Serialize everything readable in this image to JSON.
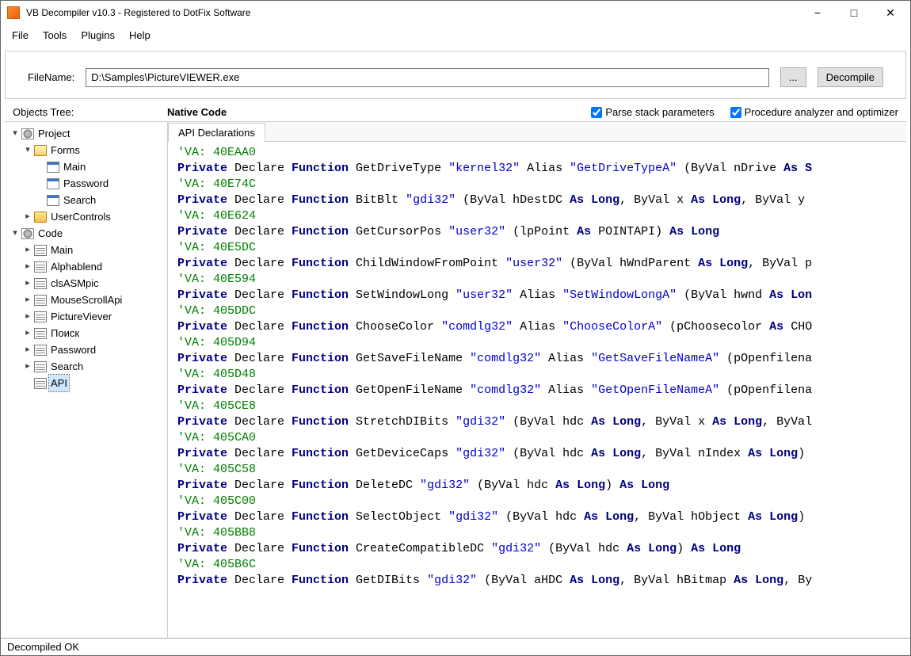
{
  "window": {
    "title": "VB Decompiler v10.3 - Registered to DotFix Software"
  },
  "menu": [
    "File",
    "Tools",
    "Plugins",
    "Help"
  ],
  "toolbar": {
    "filename_label": "FileName:",
    "filename_value": "D:\\Samples\\PictureVIEWER.exe",
    "browse": "...",
    "decompile": "Decompile"
  },
  "splitrow": {
    "objects_tree": "Objects Tree:",
    "native_code": "Native Code",
    "chk1": "Parse stack parameters",
    "chk2": "Procedure analyzer and optimizer"
  },
  "tree": {
    "project": "Project",
    "forms": "Forms",
    "form_items": [
      "Main",
      "Password",
      "Search"
    ],
    "usercontrols": "UserControls",
    "code": "Code",
    "code_items": [
      "Main",
      "Alphablend",
      "clsASMpic",
      "MouseScrollApi",
      "PictureViever",
      "Поиск",
      "Password",
      "Search",
      "API"
    ]
  },
  "tab": "API Declarations",
  "code_lines": [
    {
      "t": "comment",
      "text": "'VA: 40EAA0"
    },
    {
      "t": "decl",
      "fn": "GetDriveType",
      "lib": "kernel32",
      "alias": "GetDriveTypeA",
      "rest": " (ByVal nDrive ",
      "kw2": "As S"
    },
    {
      "t": "comment",
      "text": "'VA: 40E74C"
    },
    {
      "t": "decl",
      "fn": "BitBlt",
      "lib": "gdi32",
      "rest": " (ByVal hDestDC ",
      "kw2": "As Long",
      "rest2": ", ByVal x ",
      "kw3": "As Long",
      "rest3": ", ByVal y "
    },
    {
      "t": "comment",
      "text": "'VA: 40E624"
    },
    {
      "t": "decl",
      "fn": "GetCursorPos",
      "lib": "user32",
      "rest": " (lpPoint ",
      "kw2": "As",
      "rest2": " POINTAPI) ",
      "kw3": "As Long"
    },
    {
      "t": "comment",
      "text": "'VA: 40E5DC"
    },
    {
      "t": "decl",
      "fn": "ChildWindowFromPoint",
      "lib": "user32",
      "rest": " (ByVal hWndParent ",
      "kw2": "As Long",
      "rest2": ", ByVal p"
    },
    {
      "t": "comment",
      "text": "'VA: 40E594"
    },
    {
      "t": "decl",
      "fn": "SetWindowLong",
      "lib": "user32",
      "alias": "SetWindowLongA",
      "rest": " (ByVal hwnd ",
      "kw2": "As Lon"
    },
    {
      "t": "comment",
      "text": "'VA: 405DDC"
    },
    {
      "t": "decl",
      "fn": "ChooseColor",
      "lib": "comdlg32",
      "alias": "ChooseColorA",
      "rest": " (pChoosecolor ",
      "kw2": "As",
      "rest2": " CHO"
    },
    {
      "t": "comment",
      "text": "'VA: 405D94"
    },
    {
      "t": "decl",
      "fn": "GetSaveFileName",
      "lib": "comdlg32",
      "alias": "GetSaveFileNameA",
      "rest": " (pOpenfilena"
    },
    {
      "t": "comment",
      "text": "'VA: 405D48"
    },
    {
      "t": "decl",
      "fn": "GetOpenFileName",
      "lib": "comdlg32",
      "alias": "GetOpenFileNameA",
      "rest": " (pOpenfilena"
    },
    {
      "t": "comment",
      "text": "'VA: 405CE8"
    },
    {
      "t": "decl",
      "fn": "StretchDIBits",
      "lib": "gdi32",
      "rest": " (ByVal hdc ",
      "kw2": "As Long",
      "rest2": ", ByVal x ",
      "kw3": "As Long",
      "rest3": ", ByVal"
    },
    {
      "t": "comment",
      "text": "'VA: 405CA0"
    },
    {
      "t": "decl",
      "fn": "GetDeviceCaps",
      "lib": "gdi32",
      "rest": " (ByVal hdc ",
      "kw2": "As Long",
      "rest2": ", ByVal nIndex ",
      "kw3": "As Long",
      "rest3": ")"
    },
    {
      "t": "comment",
      "text": "'VA: 405C58"
    },
    {
      "t": "decl",
      "fn": "DeleteDC",
      "lib": "gdi32",
      "rest": " (ByVal hdc ",
      "kw2": "As Long",
      "rest2": ") ",
      "kw3": "As Long"
    },
    {
      "t": "comment",
      "text": "'VA: 405C00"
    },
    {
      "t": "decl",
      "fn": "SelectObject",
      "lib": "gdi32",
      "rest": " (ByVal hdc ",
      "kw2": "As Long",
      "rest2": ", ByVal hObject ",
      "kw3": "As Long",
      "rest3": ")"
    },
    {
      "t": "comment",
      "text": "'VA: 405BB8"
    },
    {
      "t": "decl",
      "fn": "CreateCompatibleDC",
      "lib": "gdi32",
      "rest": " (ByVal hdc ",
      "kw2": "As Long",
      "rest2": ") ",
      "kw3": "As Long"
    },
    {
      "t": "comment",
      "text": "'VA: 405B6C"
    },
    {
      "t": "decl",
      "fn": "GetDIBits",
      "lib": "gdi32",
      "rest": " (ByVal aHDC ",
      "kw2": "As Long",
      "rest2": ", ByVal hBitmap ",
      "kw3": "As Long",
      "rest3": ", By"
    }
  ],
  "status": "Decompiled OK"
}
